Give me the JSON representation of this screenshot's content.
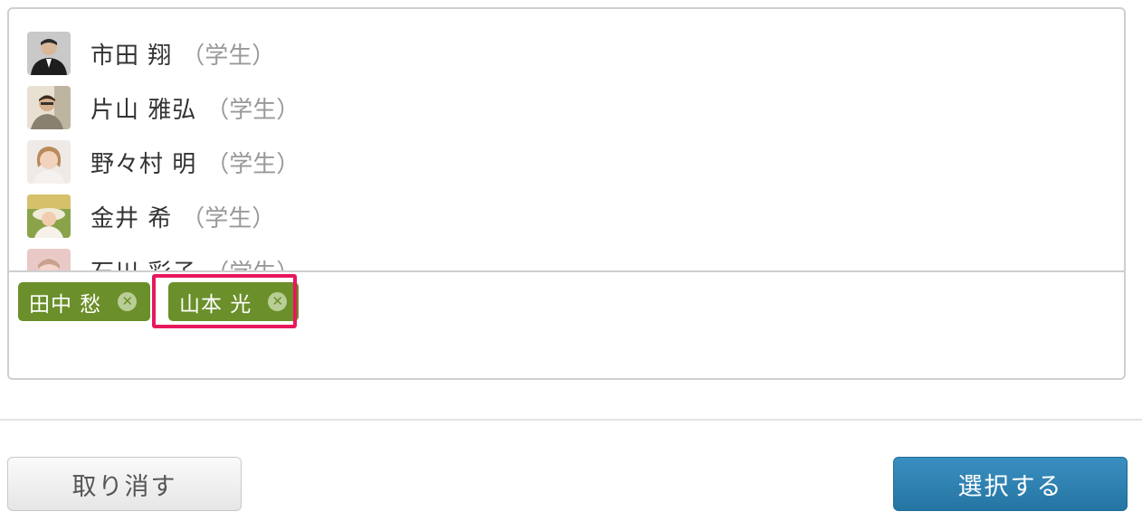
{
  "users": [
    {
      "name": "市田 翔",
      "role": "（学生）",
      "avatar": "avatar-photo-man-suit"
    },
    {
      "name": "片山 雅弘",
      "role": "（学生）",
      "avatar": "avatar-photo-man-glasses"
    },
    {
      "name": "野々村 明",
      "role": "（学生）",
      "avatar": "avatar-photo-person-light"
    },
    {
      "name": "金井 希",
      "role": "（学生）",
      "avatar": "avatar-photo-woman-outdoor"
    },
    {
      "name": "石川 彩子",
      "role": "（学生）",
      "avatar": "avatar-photo-woman-pink"
    }
  ],
  "selected": [
    {
      "label": "田中 愁",
      "remove_icon": "circle-x-icon"
    },
    {
      "label": "山本 光",
      "remove_icon": "circle-x-icon"
    }
  ],
  "buttons": {
    "cancel": "取り消す",
    "select": "選択する"
  },
  "colors": {
    "tag": "#6b8f2a",
    "primary": "#2575a3",
    "highlight": "#e8175d"
  }
}
